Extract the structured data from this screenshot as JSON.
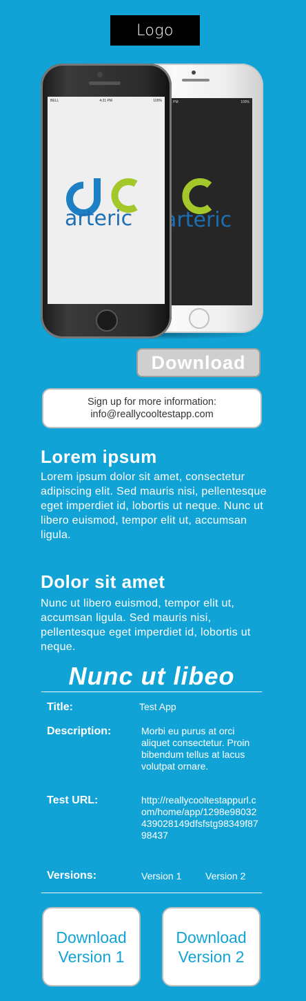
{
  "header": {
    "logo_text": "Logo"
  },
  "phones": {
    "app_logo_letters": "ac",
    "app_logo_name": "arteric",
    "status_carrier": "BELL",
    "status_time": "4:21 PM",
    "status_battery": "100%"
  },
  "download_button": "Download",
  "signup": {
    "line1": "Sign up for more information:",
    "line2": "info@reallycooltestapp.com"
  },
  "section1": {
    "title": "Lorem ipsum",
    "body": "Lorem ipsum dolor sit amet, consectetur adipiscing elit. Sed mauris nisi, pellentesque eget imperdiet id, lobortis ut neque. Nunc ut libero euismod, tempor elit ut, accumsan ligula."
  },
  "section2": {
    "title": "Dolor sit amet",
    "body": "Nunc ut libero euismod, tempor elit ut, accumsan ligula. Sed mauris nisi, pellentesque eget imperdiet id, lobortis ut neque."
  },
  "details": {
    "heading": "Nunc ut libeo",
    "title_label": "Title:",
    "title_value": "Test App",
    "description_label": "Description:",
    "description_value": "Morbi eu purus at orci aliquet consectetur. Proin bibendum tellus at lacus volutpat ornare.",
    "url_label": "Test URL:",
    "url_value": "http://reallycooltestappurl.com/home/app/1298e98032439028149dfsfstg98349f8798437",
    "versions_label": "Versions:",
    "version1": "Version 1",
    "version2": "Version 2"
  },
  "version_buttons": {
    "v1_line1": "Download",
    "v1_line2": "Version 1",
    "v2_line1": "Download",
    "v2_line2": "Version 2"
  },
  "colors": {
    "background": "#12a3d6",
    "brand_blue": "#1d7fc4",
    "brand_green": "#a4c72a"
  }
}
